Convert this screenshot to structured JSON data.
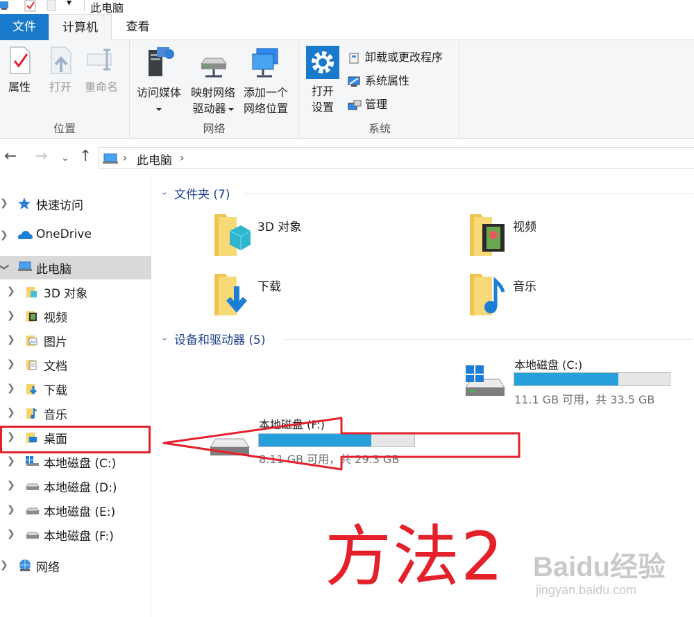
{
  "window": {
    "title": "此电脑"
  },
  "tabs": [
    {
      "label": "文件"
    },
    {
      "label": "计算机"
    },
    {
      "label": "查看"
    }
  ],
  "ribbon": {
    "location_group": {
      "label": "位置",
      "properties": "属性",
      "open": "打开",
      "rename": "重命名"
    },
    "network_group": {
      "label": "网络",
      "access_media": "访问媒体",
      "map_drive_line1": "映射网络",
      "map_drive_line2": "驱动器",
      "add_location_line1": "添加一个",
      "add_location_line2": "网络位置"
    },
    "system_group": {
      "label": "系统",
      "open_settings_line1": "打开",
      "open_settings_line2": "设置",
      "uninstall": "卸载或更改程序",
      "system_properties": "系统属性",
      "manage": "管理"
    }
  },
  "address": {
    "location": "此电脑"
  },
  "nav": [
    {
      "label": "快速访问"
    },
    {
      "label": "OneDrive"
    },
    {
      "label": "此电脑"
    },
    {
      "label": "3D 对象"
    },
    {
      "label": "视频"
    },
    {
      "label": "图片"
    },
    {
      "label": "文档"
    },
    {
      "label": "下载"
    },
    {
      "label": "音乐"
    },
    {
      "label": "桌面"
    },
    {
      "label": "本地磁盘 (C:)"
    },
    {
      "label": "本地磁盘 (D:)"
    },
    {
      "label": "本地磁盘 (E:)"
    },
    {
      "label": "本地磁盘 (F:)"
    },
    {
      "label": "网络"
    }
  ],
  "content": {
    "folders_header": "文件夹 (7)",
    "folders": [
      {
        "label": "3D 对象"
      },
      {
        "label": "视频"
      },
      {
        "label": "下载"
      },
      {
        "label": "音乐"
      }
    ],
    "drives_header": "设备和驱动器 (5)",
    "drives": [
      {
        "name": "本地磁盘 (C:)",
        "info": "11.1 GB 可用，共 33.5 GB",
        "used_fraction": 0.668
      },
      {
        "name": "本地磁盘 (F:)",
        "info": "8.11 GB 可用，共 29.3 GB",
        "used_fraction": 0.723
      }
    ]
  },
  "annotation": {
    "text": "方法2"
  },
  "watermark": {
    "brand": "Baidu经验",
    "url": "jingyan.baidu.com"
  },
  "colors": {
    "accent": "#1979ca",
    "annotation": "#e4202a",
    "drive_bar": "#26a0da"
  }
}
